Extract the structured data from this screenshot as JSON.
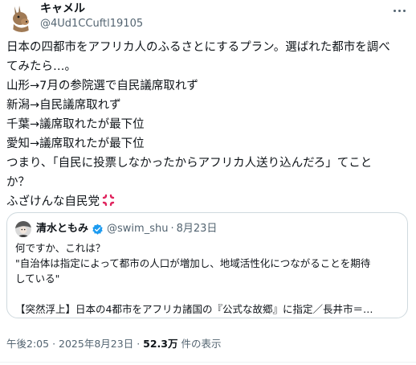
{
  "author": {
    "name": "キャメル",
    "handle": "@4Ud1CCuftl19105"
  },
  "tweet": {
    "lines": [
      "日本の四都市をアフリカ人のふるさとにするプラン。選ばれた都市を調べ",
      "てみたら…。",
      "山形→7月の参院選で自民議席取れず",
      "新潟→自民議席取れず",
      "千葉→議席取れたが最下位",
      "愛知→議席取れたが最下位",
      "つまり、「自民に投票しなかったからアフリカ人送り込んだろ」てこと",
      "か？",
      "ふざけんな自民党"
    ],
    "emoji_icon": "anger-symbol"
  },
  "quote": {
    "name": "清水ともみ",
    "handle": "@swim_shu",
    "separator": "·",
    "date": "8月23日",
    "lines": [
      "何ですか、これは？",
      "\"自治体は指定によって都市の人口が増加し、地域活性化につながることを期待",
      "している\"",
      "",
      "【突然浮上】日本の4都市をアフリカ諸国の『公式な故郷』に指定／長井市＝…"
    ],
    "verified_color": "#1d9bf0"
  },
  "meta": {
    "time": "午後2:05",
    "separator1": "·",
    "date": "2025年8月23日",
    "separator2": "·",
    "views": "52.3万",
    "views_label": "件の表示"
  },
  "colors": {
    "text": "#0f1419",
    "secondary": "#536471",
    "border": "#cfd9de",
    "anger": "#e0245e"
  }
}
